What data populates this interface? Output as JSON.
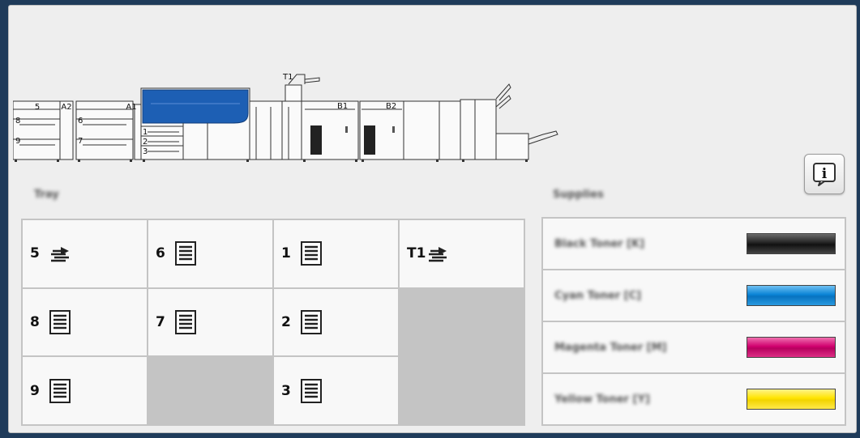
{
  "machine": {
    "labels": [
      "5",
      "A2",
      "A1",
      "8",
      "9",
      "6",
      "7",
      "1",
      "2",
      "3",
      "T1",
      "B1",
      "B2"
    ]
  },
  "info_button": {
    "icon": "info-icon",
    "label": "i"
  },
  "tray_section": {
    "title": "Tray",
    "trays": [
      {
        "number": "5",
        "icon": "bypass-tray-icon"
      },
      {
        "number": "6",
        "icon": "paper-stack-icon"
      },
      {
        "number": "1",
        "icon": "paper-stack-icon"
      },
      {
        "number": "T1",
        "icon": "bypass-tray-icon"
      },
      {
        "number": "8",
        "icon": "paper-stack-icon"
      },
      {
        "number": "7",
        "icon": "paper-stack-icon"
      },
      {
        "number": "2",
        "icon": "paper-stack-icon"
      },
      {
        "number": "9",
        "icon": "paper-stack-icon"
      },
      {
        "number": "3",
        "icon": "paper-stack-icon"
      }
    ]
  },
  "supplies_section": {
    "title": "Supplies",
    "items": [
      {
        "label": "Black Toner [K]",
        "color": "#222222"
      },
      {
        "label": "Cyan Toner [C]",
        "color": "#0a84d6"
      },
      {
        "label": "Magenta Toner [M]",
        "color": "#d0006f"
      },
      {
        "label": "Yellow Toner [Y]",
        "color": "#ffe400"
      }
    ]
  }
}
